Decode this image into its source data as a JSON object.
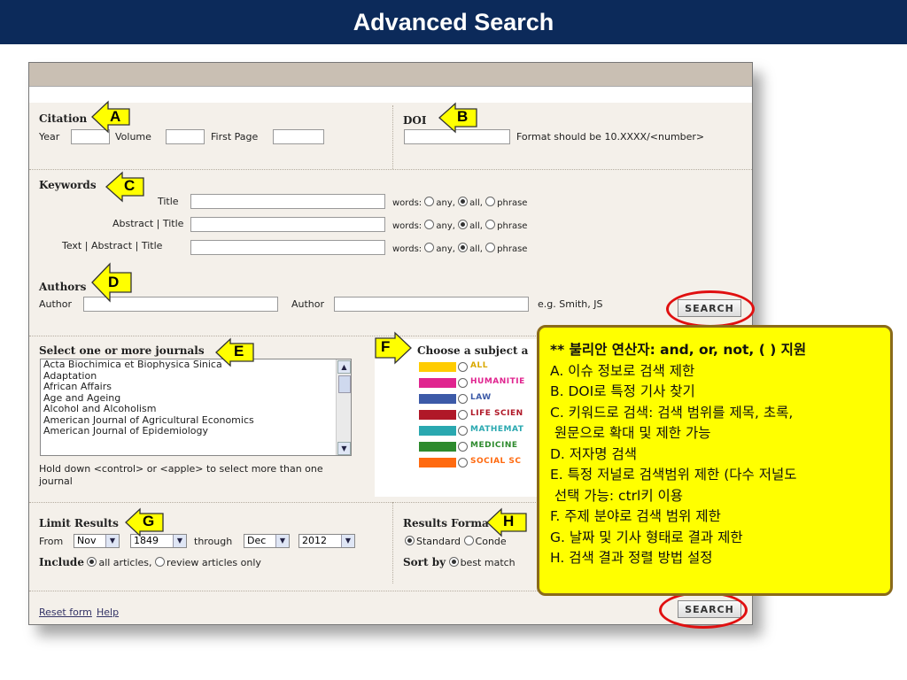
{
  "page_title": "Advanced Search",
  "citation": {
    "title": "Citation",
    "year_label": "Year",
    "volume_label": "Volume",
    "first_page_label": "First Page"
  },
  "doi": {
    "title": "DOI",
    "hint": "Format should be 10.XXXX/<number>"
  },
  "keywords": {
    "title": "Keywords",
    "rows": [
      {
        "label": "Title",
        "words_label": "words:",
        "options": [
          "any,",
          "all,",
          "phrase"
        ],
        "selected": 1
      },
      {
        "label": "Abstract | Title",
        "words_label": "words:",
        "options": [
          "any,",
          "all,",
          "phrase"
        ],
        "selected": 1
      },
      {
        "label": "Text | Abstract | Title",
        "words_label": "words:",
        "options": [
          "any,",
          "all,",
          "phrase"
        ],
        "selected": 1
      }
    ]
  },
  "authors": {
    "title": "Authors",
    "author1_label": "Author",
    "author2_label": "Author",
    "example": "e.g. Smith, JS"
  },
  "search_button": "SEARCH",
  "journals": {
    "title": "Select one or more journals",
    "items": [
      "Acta Biochimica et Biophysica Sinica",
      "Adaptation",
      "African Affairs",
      "Age and Ageing",
      "Alcohol and Alcoholism",
      "American Journal of Agricultural Economics",
      "American Journal of Epidemiology"
    ],
    "hint_line1": "Hold down <control> or <apple> to select more than one",
    "hint_line2": "journal"
  },
  "subject": {
    "title": "Choose a subject a",
    "items": [
      {
        "label": "ALL",
        "color": "#ffcc00"
      },
      {
        "label": "HUMANITIE",
        "color": "#e0248f"
      },
      {
        "label": "LAW",
        "color": "#3c5aa8"
      },
      {
        "label": "LIFE SCIEN",
        "color": "#b01828"
      },
      {
        "label": "MATHEMAT",
        "color": "#2aa8b0"
      },
      {
        "label": "MEDICINE",
        "color": "#2d8a2d"
      },
      {
        "label": "SOCIAL SC",
        "color": "#ff6a10"
      }
    ]
  },
  "limit": {
    "title": "Limit Results",
    "from_label": "From",
    "from_month": "Nov",
    "from_year": "1849",
    "through_label": "through",
    "to_month": "Dec",
    "to_year": "2012",
    "include_label": "Include",
    "opt_all": "all articles,",
    "opt_review": "review articles only"
  },
  "results_format": {
    "title": "Results Forma",
    "opt_standard": "Standard",
    "opt_conde": "Conde",
    "sort_label": "Sort by",
    "sort_value": "best match"
  },
  "footer": {
    "reset": "Reset form",
    "help": "Help"
  },
  "callouts": [
    "A",
    "B",
    "C",
    "D",
    "E",
    "F",
    "G",
    "H"
  ],
  "note": {
    "heading": "** 불리안 연산자: and, or, not, ( ) 지원",
    "lines": [
      "A. 이슈 정보로 검색 제한",
      "B. DOI로 특정 기사 찾기",
      "C. 키워드로 검색: 검색 범위를 제목, 초록,",
      " 원문으로 확대 및 제한 가능",
      "D. 저자명 검색",
      "E. 특정 저널로 검색범위 제한 (다수 저널도",
      " 선택 가능: ctrl키 이용",
      "F. 주제 분야로 검색 범위 제한",
      "G. 날짜 및 기사 형태로 결과 제한",
      "H. 검색 결과 정렬 방법 설정"
    ]
  },
  "colors": {
    "title_bg": "#0c2a5a",
    "callout_fill": "#ffff00",
    "oval": "#e01010"
  }
}
